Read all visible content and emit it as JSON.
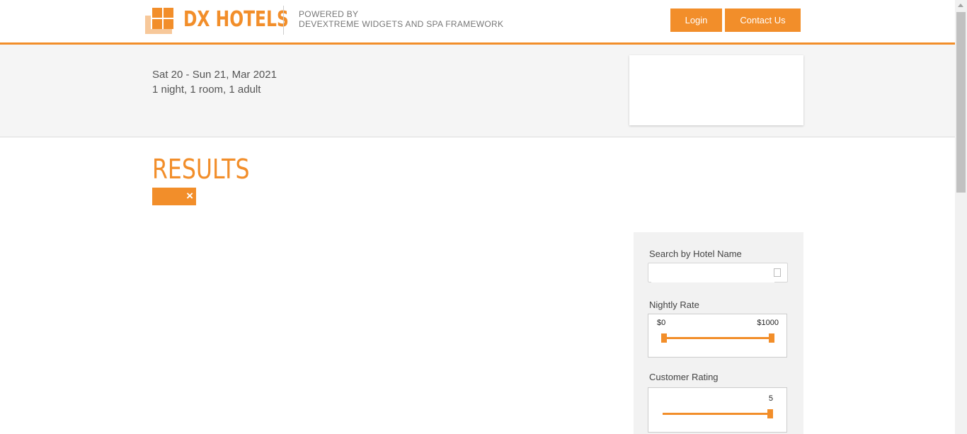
{
  "header": {
    "brand": "DX HOTELS",
    "powered_line1": "POWERED BY",
    "powered_line2": "DEVEXTREME WIDGETS AND SPA FRAMEWORK",
    "login_label": "Login",
    "contact_label": "Contact Us"
  },
  "search_summary": {
    "dates": "Sat 20 - Sun 21, Mar 2021",
    "guests": "1 night, 1 room, 1 adult"
  },
  "results": {
    "title": "RESULTS",
    "filter_tag_close": "×"
  },
  "filters": {
    "hotel_name_label": "Search by Hotel Name",
    "hotel_name_value": "",
    "nightly_rate_label": "Nightly Rate",
    "rate_min": "$0",
    "rate_max": "$1000",
    "customer_rating_label": "Customer Rating",
    "rating_value": "5"
  },
  "colors": {
    "accent": "#f28e2a",
    "band_bg": "#f5f5f5"
  }
}
